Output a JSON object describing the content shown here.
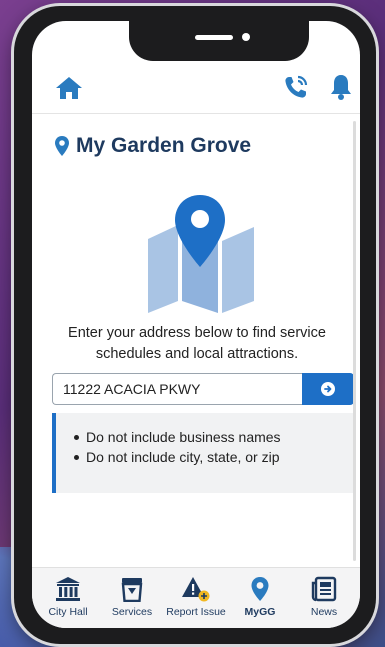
{
  "colors": {
    "brand": "#1e3a5f",
    "accent": "#1e6fc6",
    "icon": "#2a7bbf"
  },
  "topbar": {
    "home_icon": "home-icon",
    "phone_icon": "phone-ringing-icon",
    "bell_icon": "bell-icon"
  },
  "page": {
    "title": "My Garden Grove",
    "title_icon": "location-pin-icon",
    "illustration_icon": "map-pin-icon",
    "intro": "Enter your address below to find service schedules and local attractions."
  },
  "address": {
    "value": "11222 ACACIA PKWY",
    "submit_icon": "arrow-right-circle-icon"
  },
  "tips": [
    "Do not include business names",
    "Do not include city, state, or zip"
  ],
  "nav": [
    {
      "label": "City Hall",
      "icon": "city-hall-icon"
    },
    {
      "label": "Services",
      "icon": "trash-can-icon"
    },
    {
      "label": "Report Issue",
      "icon": "warning-plus-icon"
    },
    {
      "label": "MyGG",
      "icon": "location-pin-icon",
      "active": true
    },
    {
      "label": "News",
      "icon": "newspaper-icon"
    }
  ]
}
